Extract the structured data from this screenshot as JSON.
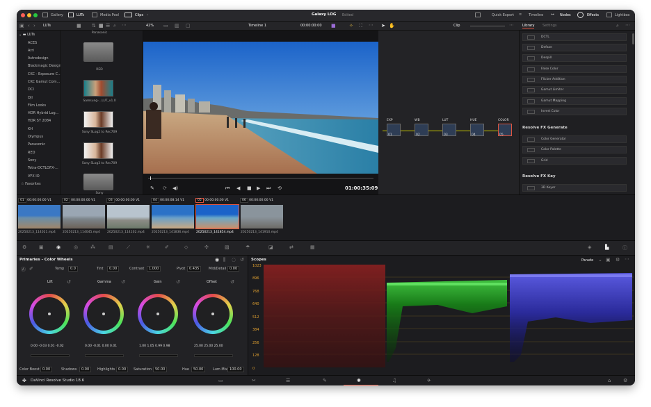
{
  "header": {
    "gallery": "Gallery",
    "luts": "LUTs",
    "media_pool": "Media Pool",
    "clips": "Clips",
    "project_title": "Galaxy LOG",
    "edited": "Edited",
    "quick_export": "Quick Export",
    "timeline": "Timeline",
    "nodes": "Nodes",
    "effects": "Effects",
    "lightbox": "Lightbox"
  },
  "toolbar": {
    "luts_label": "LUTs",
    "zoom": "42%",
    "timeline_name": "Timeline 1",
    "timecode": "00:00:00:00",
    "clip_label": "Clip",
    "library_tab": "Library",
    "settings_tab": "Settings"
  },
  "lut_list": [
    "LUTs",
    "ACES",
    "Arri",
    "Astrodesign",
    "Blackmagic Design",
    "CKC - Exposure C...",
    "CKC Gamut Com...",
    "DCI",
    "DJI",
    "Film Looks",
    "HDR Hybrid Log...",
    "HDR ST 2084",
    "KH",
    "Olympus",
    "Panasonic",
    "RED",
    "Sony",
    "Tetra-DCTLOFX-...",
    "VFX IO",
    "Favorites"
  ],
  "lut_thumbs": {
    "header": "Panasonic",
    "items": [
      "RED",
      "Samsung-...LUT_v1.0",
      "Sony SLog2 to Rec709",
      "Sony SLog3 to Rec709",
      "Sony"
    ]
  },
  "viewer": {
    "timecode": "01:00:35:09"
  },
  "nodes": [
    {
      "label": "EXP",
      "num": "01"
    },
    {
      "label": "WB",
      "num": "02"
    },
    {
      "label": "LUT",
      "num": "03"
    },
    {
      "label": "HUE",
      "num": "04"
    },
    {
      "label": "COLOR",
      "num": "05"
    }
  ],
  "library": {
    "items_top": [
      "DCTL",
      "Defaze",
      "Despill",
      "False Color",
      "Flicker Addition",
      "Gamut Limiter",
      "Gamut Mapping",
      "Invert Color"
    ],
    "section_generate": "Resolve FX Generate",
    "items_generate": [
      "Color Generator",
      "Color Palette",
      "Grid"
    ],
    "section_key": "Resolve FX Key",
    "items_key": [
      "3D Keyer"
    ]
  },
  "clips": [
    {
      "num": "01",
      "tc": "00:00:00:00",
      "track": "V1",
      "name": "20250213_114021.mp4"
    },
    {
      "num": "02",
      "tc": "00:00:00:00",
      "track": "V1",
      "name": "20250213_114045.mp4"
    },
    {
      "num": "03",
      "tc": "00:00:00:00",
      "track": "V1",
      "name": "20250213_114102.mp4"
    },
    {
      "num": "04",
      "tc": "00:00:08:14",
      "track": "V1",
      "name": "20250213_141836.mp4"
    },
    {
      "num": "05",
      "tc": "00:00:00:00",
      "track": "V1",
      "name": "20250213_141854.mp4"
    },
    {
      "num": "06",
      "tc": "00:00:00:00",
      "track": "V1",
      "name": "20250213_141910.mp4"
    }
  ],
  "primaries": {
    "title": "Primaries - Color Wheels",
    "temp_label": "Temp",
    "temp": "0.0",
    "tint_label": "Tint",
    "tint": "0.00",
    "contrast_label": "Contrast",
    "contrast": "1.000",
    "pivot_label": "Pivot",
    "pivot": "0.435",
    "middetail_label": "Mid/Detail",
    "middetail": "0.00",
    "wheels": [
      {
        "name": "Lift",
        "values": [
          "0.00",
          "-0.03",
          "0.01",
          "-0.02"
        ]
      },
      {
        "name": "Gamma",
        "values": [
          "0.00",
          "-0.01",
          "0.00",
          "0.01"
        ]
      },
      {
        "name": "Gain",
        "values": [
          "1.00",
          "1.05",
          "0.99",
          "0.98"
        ]
      },
      {
        "name": "Offset",
        "values": [
          "25.00",
          "25.00",
          "25.00"
        ]
      }
    ],
    "colorboost_label": "Color Boost",
    "colorboost": "0.00",
    "shadows_label": "Shadows",
    "shadows": "0.00",
    "highlights_label": "Highlights",
    "highlights": "0.00",
    "saturation_label": "Saturation",
    "saturation": "50.00",
    "hue_label": "Hue",
    "hue": "50.00",
    "lummix_label": "Lum Mix",
    "lummix": "100.00"
  },
  "scopes": {
    "title": "Scopes",
    "mode": "Parade",
    "y_ticks": [
      "1023",
      "896",
      "768",
      "640",
      "512",
      "384",
      "256",
      "128",
      "0"
    ]
  },
  "footer": {
    "app_name": "DaVinci Resolve Studio 18.6"
  },
  "colors": {
    "accent": "#e0543f",
    "node_line": "#c8c800"
  }
}
